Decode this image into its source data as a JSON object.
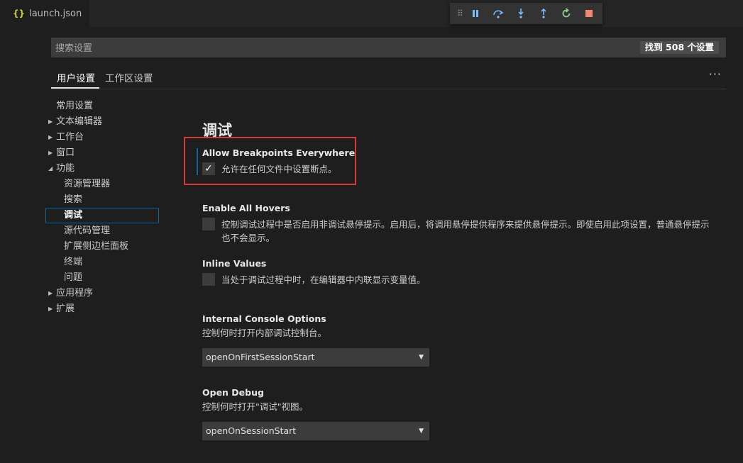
{
  "tab": {
    "icon": "json-braces-icon",
    "label": "launch.json",
    "braces": "{}"
  },
  "debug_toolbar": {
    "buttons": [
      {
        "name": "pause-icon",
        "label": "pause"
      },
      {
        "name": "step-over-icon",
        "label": "step over"
      },
      {
        "name": "step-into-icon",
        "label": "step into"
      },
      {
        "name": "step-out-icon",
        "label": "step out"
      },
      {
        "name": "restart-icon",
        "label": "restart"
      },
      {
        "name": "stop-icon",
        "label": "stop"
      }
    ],
    "colors": {
      "pause": "#75beff",
      "step": "#75beff",
      "restart": "#89d185",
      "stop": "#f48771"
    }
  },
  "search": {
    "placeholder": "搜索设置",
    "value": "",
    "result_badge": "找到 508 个设置"
  },
  "settings_tabs": {
    "user": "用户设置",
    "workspace": "工作区设置",
    "more": "···"
  },
  "toc": [
    {
      "label": "常用设置",
      "level": 1,
      "arrow": ""
    },
    {
      "label": "文本编辑器",
      "level": 1,
      "arrow": "▶"
    },
    {
      "label": "工作台",
      "level": 1,
      "arrow": "▶"
    },
    {
      "label": "窗口",
      "level": 1,
      "arrow": "▶"
    },
    {
      "label": "功能",
      "level": 1,
      "arrow": "◢"
    },
    {
      "label": "资源管理器",
      "level": 2,
      "arrow": ""
    },
    {
      "label": "搜索",
      "level": 2,
      "arrow": ""
    },
    {
      "label": "调试",
      "level": 2,
      "arrow": "",
      "selected": true
    },
    {
      "label": "源代码管理",
      "level": 2,
      "arrow": ""
    },
    {
      "label": "扩展侧边栏面板",
      "level": 2,
      "arrow": ""
    },
    {
      "label": "终端",
      "level": 2,
      "arrow": ""
    },
    {
      "label": "问题",
      "level": 2,
      "arrow": ""
    },
    {
      "label": "应用程序",
      "level": 1,
      "arrow": "▶"
    },
    {
      "label": "扩展",
      "level": 1,
      "arrow": "▶"
    }
  ],
  "section_title": "调试",
  "settings": {
    "allow_breakpoints": {
      "title": "Allow Breakpoints Everywhere",
      "description": "允许在任何文件中设置断点。",
      "checked": true,
      "check_glyph": "✓"
    },
    "enable_hovers": {
      "title": "Enable All Hovers",
      "description": "控制调试过程中是否启用非调试悬停提示。启用后，将调用悬停提供程序来提供悬停提示。即使启用此项设置，普通悬停提示也不会显示。",
      "checked": false
    },
    "inline_values": {
      "title": "Inline Values",
      "description": "当处于调试过程中时，在编辑器中内联显示变量值。",
      "checked": false
    },
    "console_options": {
      "title": "Internal Console Options",
      "description": "控制何时打开内部调试控制台。",
      "value": "openOnFirstSessionStart",
      "caret": "▼"
    },
    "open_debug": {
      "title": "Open Debug",
      "description": "控制何时打开\"调试\"视图。",
      "value": "openOnSessionStart",
      "caret": "▼"
    }
  },
  "accent": {
    "highlight_border": "#d93a33",
    "modified_bar": "#0e639c",
    "selected_outline": "#0e639c"
  }
}
